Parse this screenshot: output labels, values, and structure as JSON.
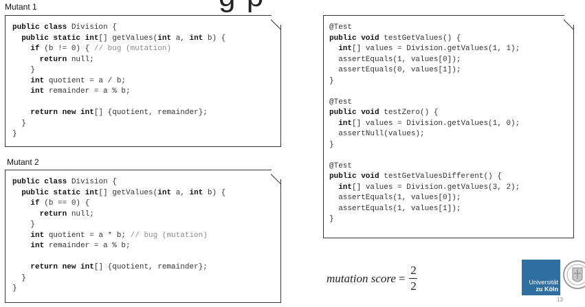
{
  "slide": {
    "title_fragment": "g      p",
    "page_number": "13"
  },
  "mutant1": {
    "label": "Mutant 1",
    "lines": [
      [
        [
          "kw",
          "public class"
        ],
        [
          "",
          "Division {"
        ]
      ],
      [
        [
          "",
          "  "
        ],
        [
          "kw",
          "public static int"
        ],
        [
          "",
          "[] getValues("
        ],
        [
          "kw",
          "int"
        ],
        [
          "",
          "a, "
        ],
        [
          "kw",
          "int"
        ],
        [
          "",
          "b) {"
        ]
      ],
      [
        [
          "",
          "    "
        ],
        [
          "kw",
          "if"
        ],
        [
          "",
          "(b != 0) { "
        ],
        [
          "cm",
          "// bug (mutation)"
        ]
      ],
      [
        [
          "",
          "      "
        ],
        [
          "kw",
          "return"
        ],
        [
          "",
          "null;"
        ]
      ],
      [
        [
          "",
          "    }"
        ]
      ],
      [
        [
          "",
          "    "
        ],
        [
          "kw",
          "int"
        ],
        [
          "",
          "quotient = a / b;"
        ]
      ],
      [
        [
          "",
          "    "
        ],
        [
          "kw",
          "int"
        ],
        [
          "",
          "remainder = a % b;"
        ]
      ],
      [
        [
          "",
          ""
        ]
      ],
      [
        [
          "",
          "    "
        ],
        [
          "kw",
          "return new int"
        ],
        [
          "",
          "[] {quotient, remainder};"
        ]
      ],
      [
        [
          "",
          "  }"
        ]
      ],
      [
        [
          "",
          "}"
        ]
      ]
    ]
  },
  "mutant2": {
    "label": "Mutant 2",
    "lines": [
      [
        [
          "kw",
          "public class"
        ],
        [
          "",
          "Division {"
        ]
      ],
      [
        [
          "",
          "  "
        ],
        [
          "kw",
          "public static int"
        ],
        [
          "",
          "[] getValues("
        ],
        [
          "kw",
          "int"
        ],
        [
          "",
          "a, "
        ],
        [
          "kw",
          "int"
        ],
        [
          "",
          "b) {"
        ]
      ],
      [
        [
          "",
          "    "
        ],
        [
          "kw",
          "if"
        ],
        [
          "",
          "(b == 0) {"
        ]
      ],
      [
        [
          "",
          "      "
        ],
        [
          "kw",
          "return"
        ],
        [
          "",
          "null;"
        ]
      ],
      [
        [
          "",
          "    }"
        ]
      ],
      [
        [
          "",
          "    "
        ],
        [
          "kw",
          "int"
        ],
        [
          "",
          "quotient = a * b; "
        ],
        [
          "cm",
          "// bug (mutation)"
        ]
      ],
      [
        [
          "",
          "    "
        ],
        [
          "kw",
          "int"
        ],
        [
          "",
          "remainder = a % b;"
        ]
      ],
      [
        [
          "",
          ""
        ]
      ],
      [
        [
          "",
          "    "
        ],
        [
          "kw",
          "return new int"
        ],
        [
          "",
          "[] {quotient, remainder};"
        ]
      ],
      [
        [
          "",
          "  }"
        ]
      ],
      [
        [
          "",
          "}"
        ]
      ]
    ]
  },
  "tests": {
    "lines": [
      [
        [
          "",
          "@Test"
        ]
      ],
      [
        [
          "kw",
          "public void"
        ],
        [
          "",
          "testGetValues() {"
        ]
      ],
      [
        [
          "",
          "  "
        ],
        [
          "kw",
          "int"
        ],
        [
          "",
          "[] values = Division.getValues(1, 1);"
        ]
      ],
      [
        [
          "",
          "  assertEquals(1, values[0]);"
        ]
      ],
      [
        [
          "",
          "  assertEquals(0, values[1]);"
        ]
      ],
      [
        [
          "",
          "}"
        ]
      ],
      [
        [
          "",
          ""
        ]
      ],
      [
        [
          "",
          "@Test"
        ]
      ],
      [
        [
          "kw",
          "public void"
        ],
        [
          "",
          "testZero() {"
        ]
      ],
      [
        [
          "",
          "  "
        ],
        [
          "kw",
          "int"
        ],
        [
          "",
          "[] values = Division.getValues(1, 0);"
        ]
      ],
      [
        [
          "",
          "  assertNull(values);"
        ]
      ],
      [
        [
          "",
          "}"
        ]
      ],
      [
        [
          "",
          ""
        ]
      ],
      [
        [
          "",
          "@Test"
        ]
      ],
      [
        [
          "kw",
          "public void"
        ],
        [
          "",
          "testGetValuesDifferent() {"
        ]
      ],
      [
        [
          "",
          "  "
        ],
        [
          "kw",
          "int"
        ],
        [
          "",
          "[] values = Division.getValues(3, 2);"
        ]
      ],
      [
        [
          "",
          "  assertEquals(1, values[0]);"
        ]
      ],
      [
        [
          "",
          "  assertEquals(1, values[1]);"
        ]
      ],
      [
        [
          "",
          "}"
        ]
      ]
    ]
  },
  "score": {
    "label": "mutation score",
    "equals": "=",
    "numerator": "2",
    "denominator": "2"
  },
  "logo": {
    "line1": "Universität",
    "line2": "zu Köln"
  }
}
